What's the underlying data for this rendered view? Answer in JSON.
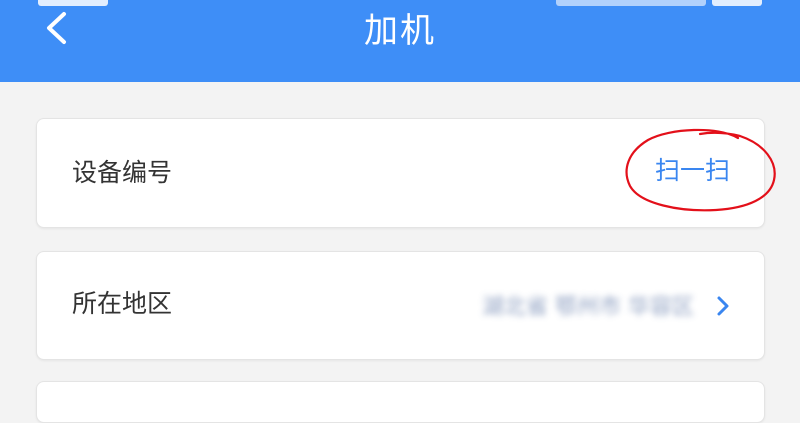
{
  "header": {
    "title": "加机",
    "background_color": "#3e8ef7",
    "back_icon": "chevron-left-icon"
  },
  "form": {
    "device_number": {
      "label": "设备编号",
      "action_label": "扫一扫",
      "action_color": "#3a86f0",
      "annotation_color": "#e3101a"
    },
    "region": {
      "label": "所在地区",
      "value": "湖北省 鄂州市 华容区",
      "value_obscured": true,
      "icon": "chevron-right-icon"
    }
  }
}
